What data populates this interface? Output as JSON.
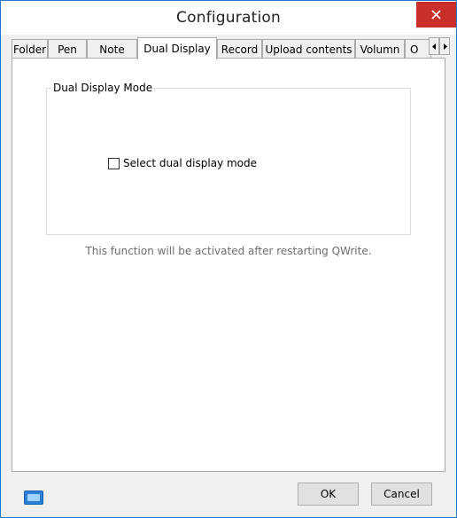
{
  "window": {
    "title": "Configuration"
  },
  "tabs": [
    {
      "label": "Folder"
    },
    {
      "label": "Pen"
    },
    {
      "label": "Note"
    },
    {
      "label": "Dual Display",
      "active": true
    },
    {
      "label": "Record"
    },
    {
      "label": "Upload contents"
    },
    {
      "label": "Volumn"
    },
    {
      "label": "O"
    }
  ],
  "icons": {
    "close": "close-icon",
    "scroll_left": "arrow-left-icon",
    "scroll_right": "arrow-right-icon",
    "keyboard": "keyboard-icon"
  },
  "dual_display": {
    "group_title": "Dual Display Mode",
    "checkbox_label": "Select dual display mode",
    "checked": false,
    "note": "This function will be activated after restarting QWrite."
  },
  "footer": {
    "ok_label": "OK",
    "cancel_label": "Cancel"
  },
  "colors": {
    "close_button": "#c9302c",
    "window_border": "#1d7ad1",
    "keyboard_icon": "#2c7fd6"
  }
}
